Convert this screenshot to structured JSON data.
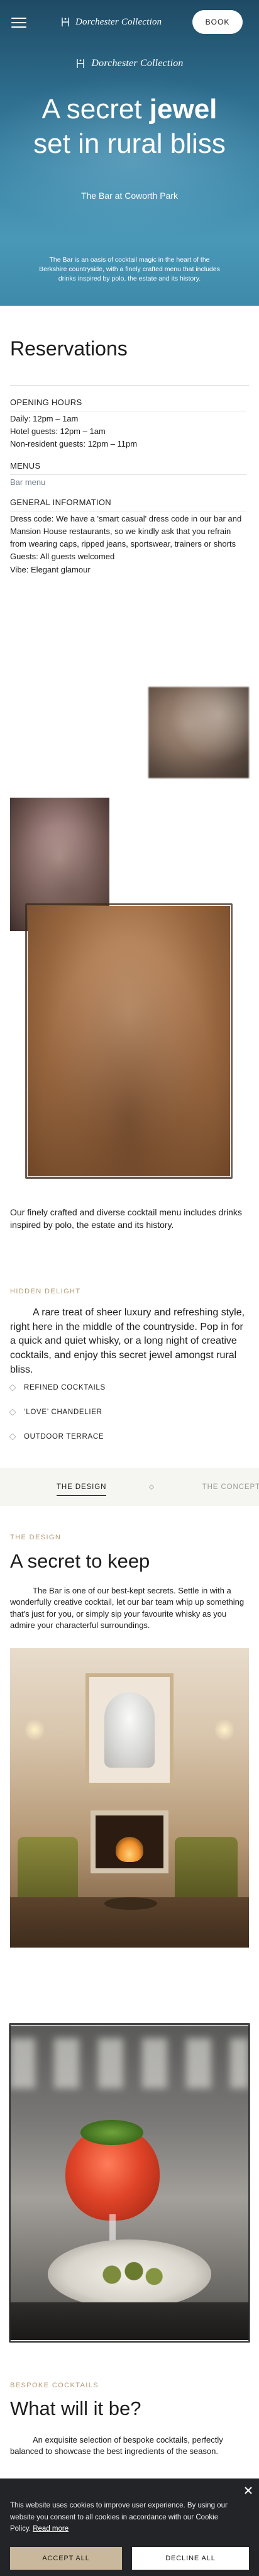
{
  "header": {
    "brand": "Dorchester Collection",
    "book_label": "BOOK"
  },
  "hero": {
    "logo_text": "Dorchester Collection",
    "title_part1": "A secret ",
    "title_emphasis": "jewel",
    "title_line2": "set in rural bliss",
    "subtitle": "The Bar at Coworth Park",
    "description": "The Bar is an oasis of cocktail magic in the heart of the Berkshire countryside, with a finely crafted menu that includes drinks inspired by polo, the estate and its history."
  },
  "reservations": {
    "title": "Reservations",
    "opening_hours_heading": "OPENING HOURS",
    "hours": [
      "Daily: 12pm – 1am",
      "Hotel guests: 12pm – 1am",
      "Non-resident guests: 12pm – 11pm"
    ],
    "menus_heading": "MENUS",
    "menu_link": "Bar menu",
    "general_heading": "GENERAL INFORMATION",
    "dress_code": "Dress code: We have a 'smart casual' dress code in our bar and Mansion House restaurants, so we kindly ask that you refrain from wearing caps, ripped jeans, sportswear, trainers or shorts",
    "guests": "Guests: All guests welcomed",
    "vibe": "Vibe: Elegant glamour"
  },
  "gallery": {
    "caption": "Our finely crafted and diverse cocktail menu includes drinks inspired by polo, the estate and its history."
  },
  "hidden_delight": {
    "eyebrow": "HIDDEN DELIGHT",
    "lead": "A rare treat of sheer luxury and refreshing style, right here in the middle of the countryside. Pop in for a quick and quiet whisky, or a long night of creative cocktails, and enjoy this secret jewel amongst rural bliss.",
    "features": [
      "REFINED COCKTAILS",
      "‘LOVE’ CHANDELIER",
      "OUTDOOR TERRACE"
    ]
  },
  "tabs": {
    "design": "THE DESIGN",
    "concept": "THE CONCEPT"
  },
  "design": {
    "eyebrow": "THE DESIGN",
    "title": "A secret to keep",
    "text": "The Bar is one of our best-kept secrets. Settle in with a wonderfully creative cocktail, let our bar team whip up something that's just for you, or simply sip your favourite whisky as you admire your characterful surroundings."
  },
  "cocktails": {
    "eyebrow": "BESPOKE COCKTAILS",
    "title": "What will it be?",
    "text": "An exquisite selection of bespoke cocktails, perfectly balanced to showcase the best ingredients of the season."
  },
  "cookie": {
    "text": "This website uses cookies to improve user experience. By using our website you consent to all cookies in accordance with our Cookie Policy.",
    "read_more": "Read more",
    "accept_label": "ACCEPT ALL",
    "decline_label": "DECLINE ALL"
  },
  "colors": {
    "hero_blue": "#2c6a8a",
    "accent_gold": "#b59b74",
    "link_grey": "#6f7d8b",
    "cookie_bg": "#222427",
    "accept_bg": "#c9b89b"
  },
  "icons": {
    "menu": "hamburger-icon",
    "brand": "dorchester-crest-icon",
    "feature_bullet": "diamond-icon",
    "close": "close-icon"
  }
}
